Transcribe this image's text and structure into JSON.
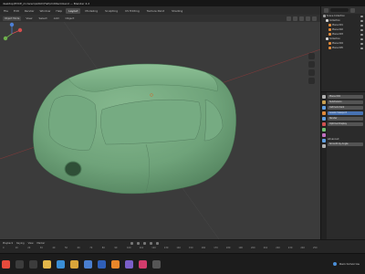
{
  "window": {
    "title": "desktop\\EVCE_mclaren\\Glitch\\Fiat\\Untitled.blend — Blender 4.2"
  },
  "menubar": {
    "items": [
      "File",
      "Edit",
      "Render",
      "Window",
      "Help"
    ],
    "workspaces": [
      "Layout",
      "Modeling",
      "Sculpting",
      "UV Editing",
      "Texture Paint",
      "Shading"
    ],
    "active_workspace": "Layout",
    "scene_label": "Scene"
  },
  "viewport_header": {
    "mode": "Object Mode",
    "view": "View",
    "select": "Select",
    "add": "Add",
    "object": "Object"
  },
  "outliner": {
    "search_placeholder": "",
    "rows": [
      {
        "label": "Scene Collection",
        "depth": 0,
        "color": "#9a9a9a"
      },
      {
        "label": "Collection",
        "depth": 1,
        "color": "#d8d8d8"
      },
      {
        "label": "Plane.001",
        "depth": 2,
        "color": "#e08a3a"
      },
      {
        "label": "Plane.002",
        "depth": 2,
        "color": "#e08a3a"
      },
      {
        "label": "Plane.003",
        "depth": 2,
        "color": "#e08a3a"
      },
      {
        "label": "Collection",
        "depth": 1,
        "color": "#d8d8d8"
      },
      {
        "label": "Plane.004",
        "depth": 2,
        "color": "#e08a3a"
      },
      {
        "label": "Plane.005",
        "depth": 2,
        "color": "#e08a3a"
      }
    ]
  },
  "properties": {
    "object_name": "Plane.004",
    "modifier_label": "Subdivision",
    "field1": "Catmull-Clark",
    "field2": "Levels Viewport",
    "field3": "Render",
    "field4": "Optimal Display",
    "section": "Advanced",
    "field5": "Smooth by Angle",
    "tab_colors": [
      "#b0b0b0",
      "#c8a050",
      "#5f9ee0",
      "#e08a3a",
      "#5f9ee0",
      "#d05050",
      "#6fbf6f",
      "#c070c0",
      "#5f9ee0",
      "#b0b0b0"
    ]
  },
  "timeline": {
    "playback": "Playback",
    "keying": "Keying",
    "view": "View",
    "marker": "Marker",
    "ticks": [
      "0",
      "10",
      "20",
      "30",
      "40",
      "50",
      "60",
      "70",
      "80",
      "90",
      "100",
      "110",
      "120",
      "130",
      "140",
      "150",
      "160",
      "170",
      "180",
      "190",
      "200",
      "210",
      "220",
      "230",
      "240",
      "250"
    ]
  },
  "taskbar": {
    "icons": [
      {
        "name": "start-icon",
        "color": "#e64b3c"
      },
      {
        "name": "search-icon",
        "color": "#3c3c3c"
      },
      {
        "name": "task-view-icon",
        "color": "#3c3c3c"
      },
      {
        "name": "explorer-icon",
        "color": "#e2b64a"
      },
      {
        "name": "edge-icon",
        "color": "#3a8fd6"
      },
      {
        "name": "chrome-icon",
        "color": "#d9a53a"
      },
      {
        "name": "store-icon",
        "color": "#4a7fd0"
      },
      {
        "name": "photoshop-icon",
        "color": "#2f5fb8"
      },
      {
        "name": "blender-icon",
        "color": "#e8862a"
      },
      {
        "name": "app-icon",
        "color": "#7a5fc8"
      },
      {
        "name": "media-icon",
        "color": "#d23c6c"
      },
      {
        "name": "terminal-icon",
        "color": "#555555"
      }
    ],
    "tray_text": "Rain tomorrow"
  },
  "colors": {
    "model": "#6fa37a",
    "accent": "#4772b3"
  }
}
